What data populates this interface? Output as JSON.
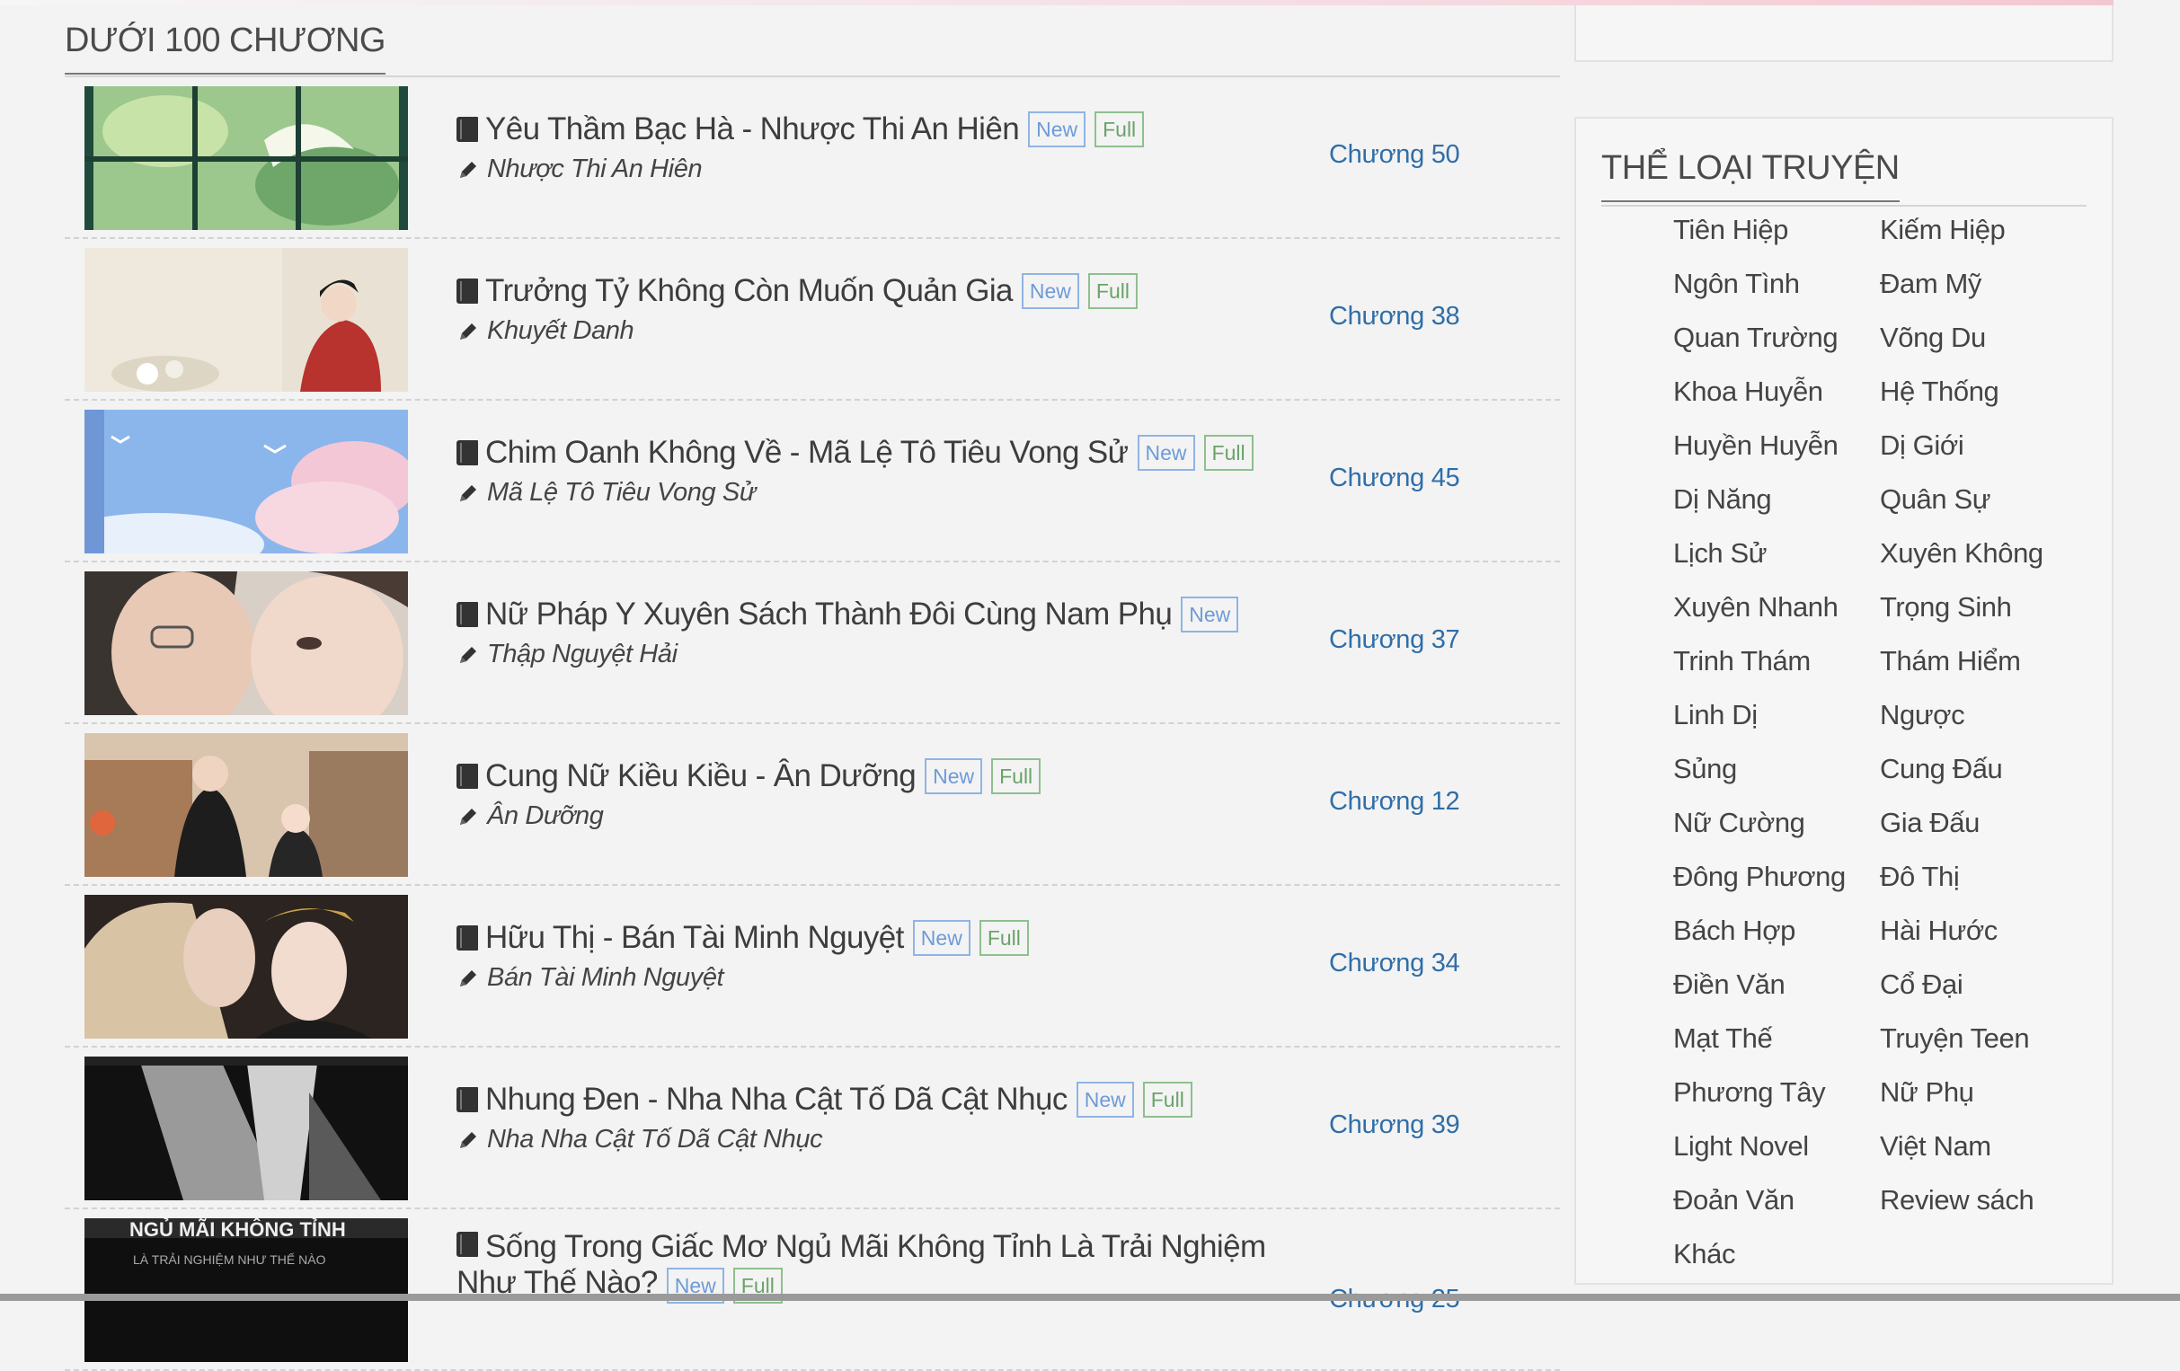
{
  "section": {
    "title": "DƯỚI 100 CHƯƠNG"
  },
  "stories": [
    {
      "title": "Yêu Thầm Bạc Hà - Nhược Thi An Hiên",
      "author": "Nhược Thi An Hiên",
      "new": "New",
      "full": "Full",
      "chapter": "Chương 50",
      "thumb": "window"
    },
    {
      "title": "Trưởng Tỷ Không Còn Muốn Quản Gia",
      "author": "Khuyết Danh",
      "new": "New",
      "full": "Full",
      "chapter": "Chương 38",
      "thumb": "lady"
    },
    {
      "title": "Chim Oanh Không Về - Mã Lệ Tô Tiêu Vong Sử",
      "author": "Mã Lệ Tô Tiêu Vong Sử",
      "new": "New",
      "full": "Full",
      "chapter": "Chương 45",
      "thumb": "sky"
    },
    {
      "title": "Nữ Pháp Y Xuyên Sách Thành Đôi Cùng Nam Phụ",
      "author": "Thập Nguyệt Hải",
      "new": "New",
      "full": "",
      "chapter": "Chương 37",
      "thumb": "couple"
    },
    {
      "title": "Cung Nữ Kiều Kiều - Ân Dưỡng",
      "author": "Ân Dưỡng",
      "new": "New",
      "full": "Full",
      "chapter": "Chương 12",
      "thumb": "street"
    },
    {
      "title": "Hữu Thị - Bán Tài Minh Nguyệt",
      "author": "Bán Tài Minh Nguyệt",
      "new": "New",
      "full": "Full",
      "chapter": "Chương 34",
      "thumb": "embrace"
    },
    {
      "title": "Nhung Đen - Nha Nha Cật Tố Dã Cật Nhục",
      "author": "Nha Nha Cật Tố Dã Cật Nhục",
      "new": "New",
      "full": "Full",
      "chapter": "Chương 39",
      "thumb": "mono"
    },
    {
      "title": "Sống Trong Giấc Mơ Ngủ Mãi Không Tỉnh Là Trải Nghiệm Như Thế Nào?",
      "author": "",
      "new": "New",
      "full": "Full",
      "chapter": "Chương 25",
      "thumb": "dark",
      "thumb_text": "NGỦ MÃI KHÔNG TỈNH",
      "thumb_sub": "LÀ TRẢI NGHIỆM NHƯ THẾ NÀO"
    }
  ],
  "sidebar": {
    "title": "THỂ LOẠI TRUYỆN",
    "genres": [
      "Tiên Hiệp",
      "Kiếm Hiệp",
      "Ngôn Tình",
      "Đam Mỹ",
      "Quan Trường",
      "Võng Du",
      "Khoa Huyễn",
      "Hệ Thống",
      "Huyền Huyễn",
      "Dị Giới",
      "Dị Năng",
      "Quân Sự",
      "Lịch Sử",
      "Xuyên Không",
      "Xuyên Nhanh",
      "Trọng Sinh",
      "Trinh Thám",
      "Thám Hiểm",
      "Linh Dị",
      "Ngược",
      "Sủng",
      "Cung Đấu",
      "Nữ Cường",
      "Gia Đấu",
      "Đông Phương",
      "Đô Thị",
      "Bách Hợp",
      "Hài Hước",
      "Điền Văn",
      "Cổ Đại",
      "Mạt Thế",
      "Truyện Teen",
      "Phương Tây",
      "Nữ Phụ",
      "Light Novel",
      "Việt Nam",
      "Đoản Văn",
      "Review sách",
      "Khác"
    ]
  },
  "colors": {
    "chapter": "#2f6ea8",
    "tag_new": "#6d9bd8",
    "tag_full": "#6aa36a",
    "background": "#f3f3f3"
  },
  "icons": {
    "book": "book-icon",
    "author": "pencil-icon"
  }
}
